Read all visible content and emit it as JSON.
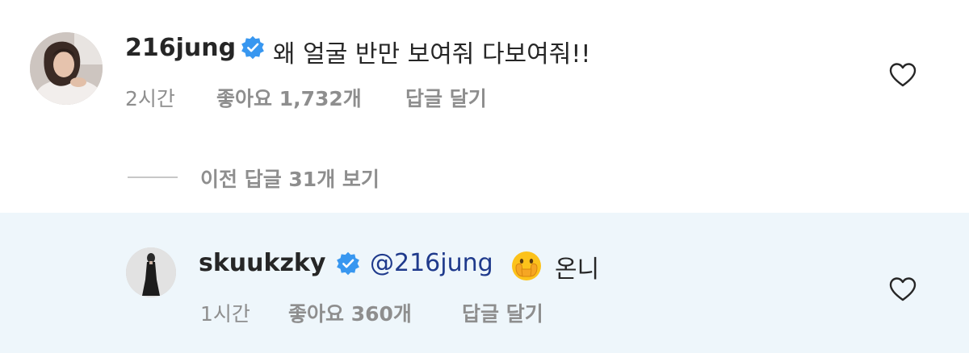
{
  "comments": [
    {
      "username": "216jung",
      "text": "왜 얼굴 반만 보여줘 다보여줘!!",
      "time": "2시간",
      "likes": "좋아요 1,732개",
      "reply": "답글 달기"
    },
    {
      "username": "skuukzky",
      "mention": "@216jung",
      "text": "온니",
      "time": "1시간",
      "likes": "좋아요 360개",
      "reply": "답글 달기"
    }
  ],
  "view_previous": "이전 답글 31개 보기",
  "icons": {
    "verified": "verified-badge-icon",
    "like": "heart-outline-icon",
    "emoji": "face-with-hand-over-mouth-emoji"
  },
  "colors": {
    "verified_blue": "#3897f0",
    "reply_highlight_bg": "#eef6fb",
    "mention": "#1f3a8c",
    "meta_gray": "#8e8e8e"
  }
}
